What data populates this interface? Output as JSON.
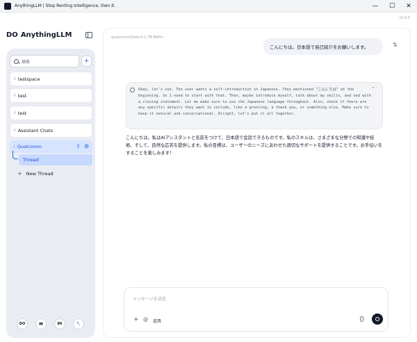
{
  "window": {
    "title": "AnythingLLM | Stop Renting Intelligence, Own It.",
    "controls": [
      "—",
      "☐",
      "✕"
    ]
  },
  "sidebar": {
    "logo_glyph": "DO",
    "brand": "AnythingLLM",
    "search_placeholder": "検索",
    "add_label": "+",
    "workspaces": [
      {
        "label": "testspace"
      },
      {
        "label": "test"
      },
      {
        "label": "test"
      },
      {
        "label": "Assistant Chats"
      }
    ],
    "active_workspace": {
      "label": "Qualcomm"
    },
    "thread": {
      "label": "Thread"
    },
    "new_thread": {
      "plus": "+",
      "label": "New Thread"
    },
    "footer": [
      "DO",
      "▮▮",
      "86",
      "🔧"
    ]
  },
  "main": {
    "version": "v1.9.0",
    "model": "qualcomm/Qwen3-1.7B-NNHn",
    "user_message": "こんにちは。日本語で自己紹介をお願いします。",
    "thinking": "Okay, let's see. The user wants a self-introduction in Japanese. They mentioned \"こんにちは\" at the beginning. So I need to start with that. Then, maybe introduce myself, talk about my skills, and end with a closing statement. Let me make sure to use the Japanese language throughout. Also, check if there are any specific details they want to include, like a greeting, a thank you, or something else. Make sure to keep it natural and conversational. Alright, let's put it all together.",
    "reply": "こんにちは。私はAIアシスタントと名前をつけて、日本語で会話できるものです。私のスキルは、さまざまな分野での知識や技術、そして、自然な応答を提供します。私の目標は、ユーザーのニーズにあわせた適切なサポートを提供することです。お手伝いをすることを楽しみます！",
    "composer": {
      "placeholder": "メッセージを送信",
      "plus": "+",
      "at": "@",
      "tools": "道具"
    }
  }
}
